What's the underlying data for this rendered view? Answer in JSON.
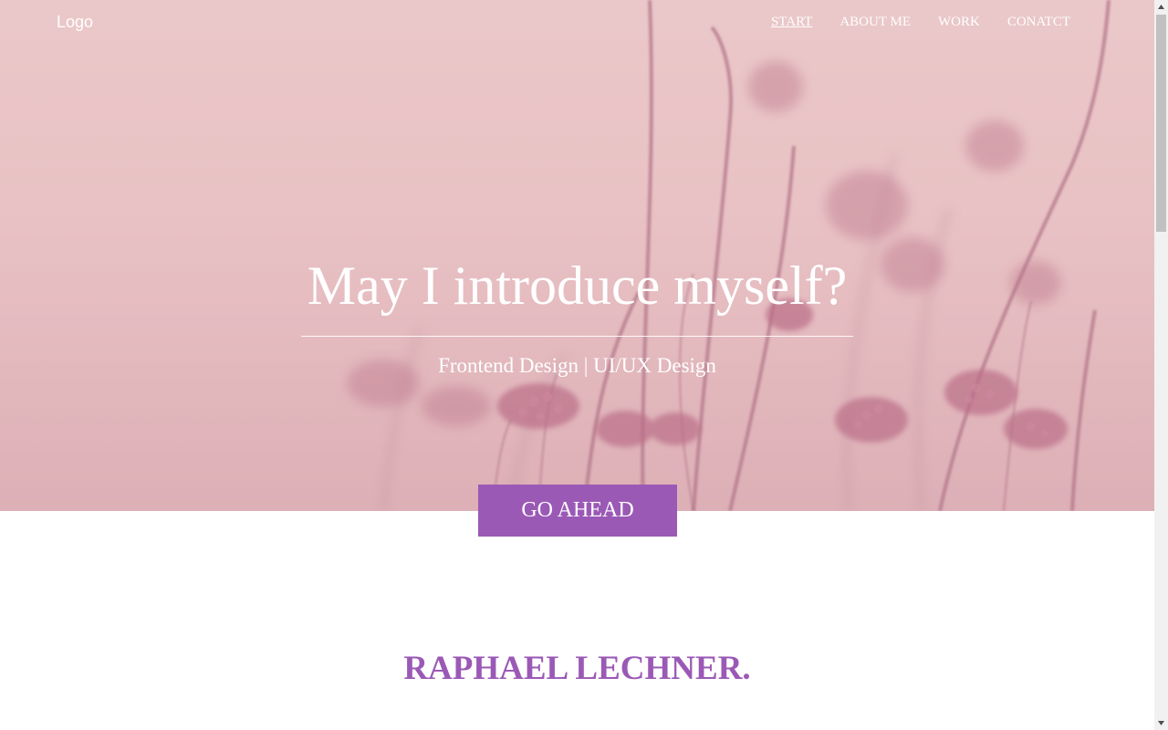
{
  "header": {
    "logo": "Logo",
    "nav": [
      {
        "label": "START",
        "active": true
      },
      {
        "label": "ABOUT ME",
        "active": false
      },
      {
        "label": "WORK",
        "active": false
      },
      {
        "label": "CONATCT",
        "active": false
      }
    ]
  },
  "hero": {
    "title": "May I introduce myself?",
    "subtitle": "Frontend Design | UI/UX Design",
    "cta_label": "GO AHEAD"
  },
  "about": {
    "name": "RAPHAEL LECHNER."
  },
  "colors": {
    "accent": "#9b59b6",
    "hero_tint": "#e7bfc2",
    "text_on_hero": "#ffffff"
  },
  "icons": {
    "scroll_up": "triangle-up-icon",
    "scroll_down": "triangle-down-icon"
  }
}
